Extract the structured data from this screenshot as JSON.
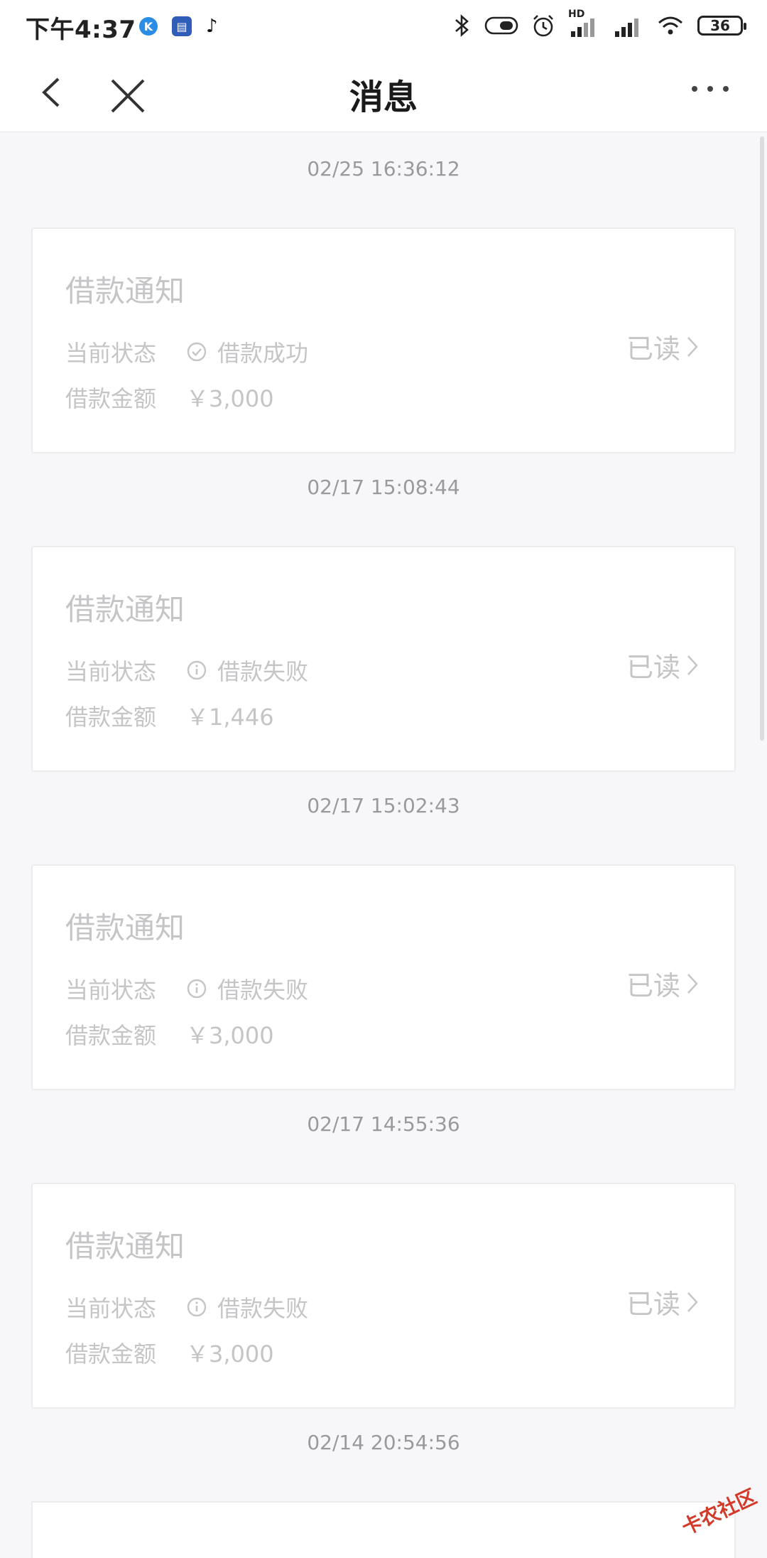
{
  "status_bar": {
    "time": "下午4:37",
    "battery": "36",
    "network_label": "HD"
  },
  "nav": {
    "title": "消息"
  },
  "messages": [
    {
      "timestamp": "02/25 16:36:12",
      "title": "借款通知",
      "status_label": "当前状态",
      "status_value": "借款成功",
      "status_icon": "check-circle-icon",
      "amount_label": "借款金额",
      "amount_value": "￥3,000",
      "read_state": "已读"
    },
    {
      "timestamp": "02/17 15:08:44",
      "title": "借款通知",
      "status_label": "当前状态",
      "status_value": "借款失败",
      "status_icon": "info-circle-icon",
      "amount_label": "借款金额",
      "amount_value": "￥1,446",
      "read_state": "已读"
    },
    {
      "timestamp": "02/17 15:02:43",
      "title": "借款通知",
      "status_label": "当前状态",
      "status_value": "借款失败",
      "status_icon": "info-circle-icon",
      "amount_label": "借款金额",
      "amount_value": "￥3,000",
      "read_state": "已读"
    },
    {
      "timestamp": "02/17 14:55:36",
      "title": "借款通知",
      "status_label": "当前状态",
      "status_value": "借款失败",
      "status_icon": "info-circle-icon",
      "amount_label": "借款金额",
      "amount_value": "￥3,000",
      "read_state": "已读"
    }
  ],
  "next_timestamp": "02/14 20:54:56",
  "watermark": "卡农社区"
}
